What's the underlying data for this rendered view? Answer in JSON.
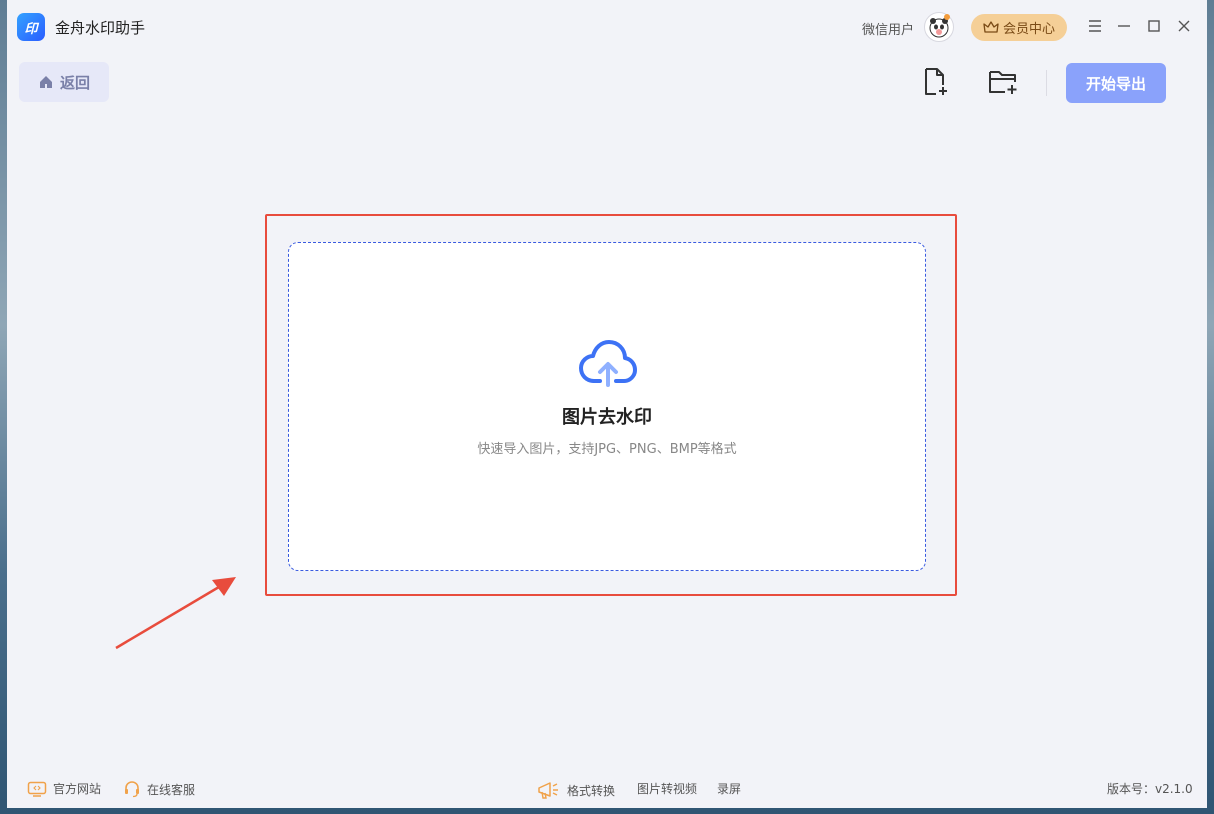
{
  "app": {
    "title": "金舟水印助手",
    "logo_text": "印"
  },
  "header": {
    "user_name": "微信用户",
    "vip_label": "会员中心"
  },
  "toolbar": {
    "back_label": "返回",
    "export_label": "开始导出"
  },
  "dropzone": {
    "title": "图片去水印",
    "subtitle": "快速导入图片，支持JPG、PNG、BMP等格式"
  },
  "footer": {
    "website": "官方网站",
    "support": "在线客服",
    "links": [
      "格式转换",
      "图片转视频",
      "录屏"
    ],
    "version": "版本号：v2.1.0"
  },
  "colors": {
    "accent": "#8aa2fb",
    "highlight": "#e84c3d",
    "vip": "#f5cf97",
    "dashed_border": "#3a5be0"
  }
}
